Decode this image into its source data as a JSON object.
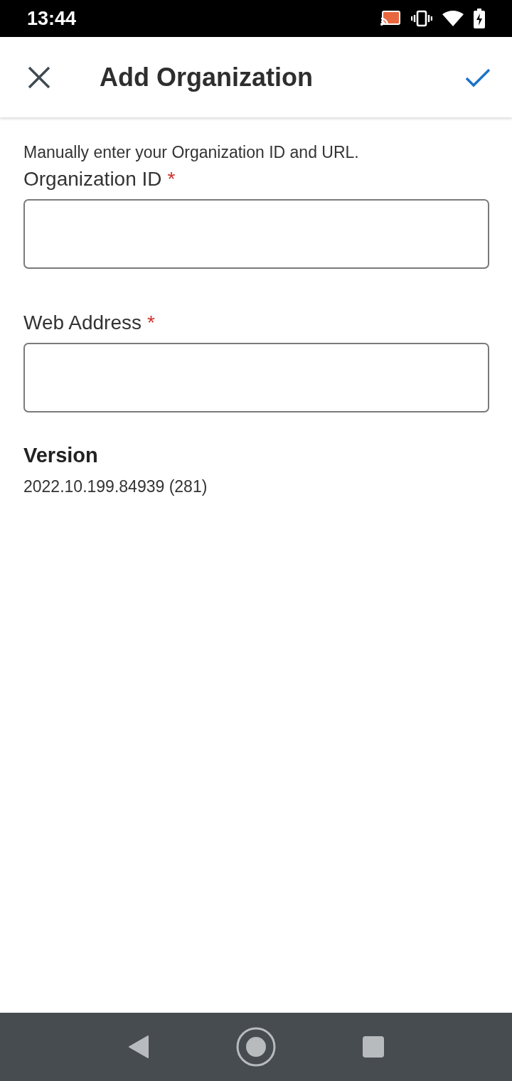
{
  "status_bar": {
    "time": "13:44"
  },
  "app_bar": {
    "title": "Add Organization"
  },
  "intro": "Manually enter your Organization ID and URL.",
  "fields": [
    {
      "label": "Organization ID",
      "required_mark": "*"
    },
    {
      "label": "Web Address",
      "required_mark": "*"
    }
  ],
  "version": {
    "heading": "Version",
    "value": "2022.10.199.84939 (281)"
  }
}
